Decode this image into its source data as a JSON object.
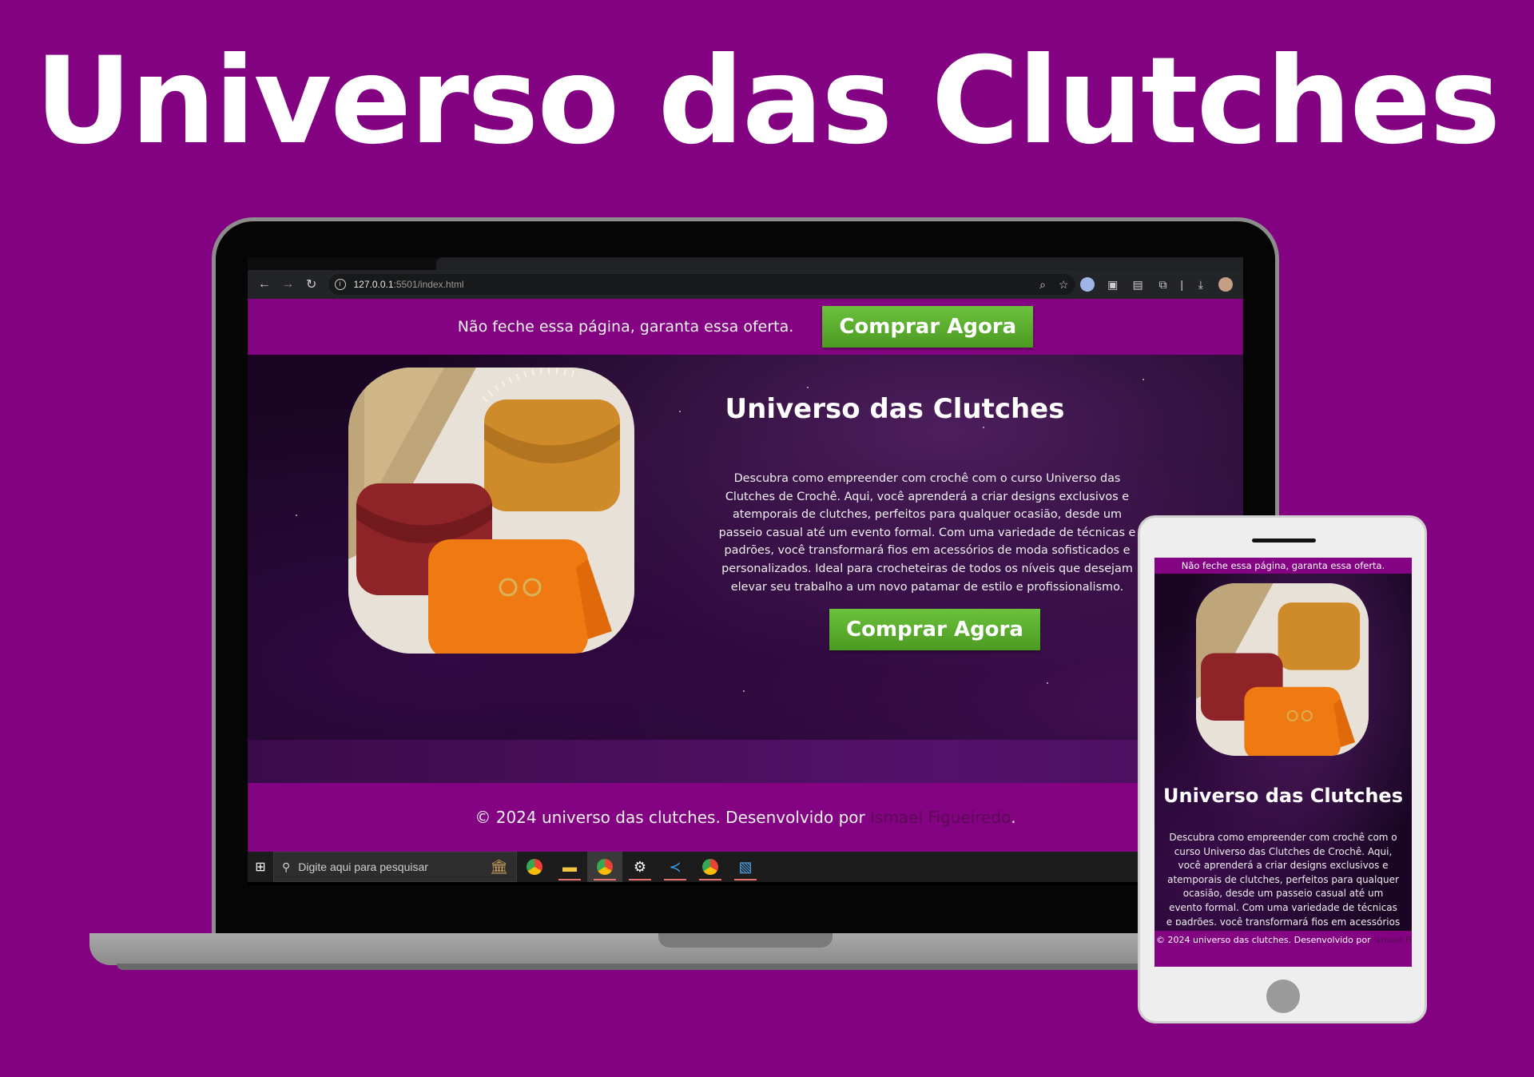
{
  "headline": "Universo das Clutches",
  "browser": {
    "url_host": "127.0.0.1",
    "url_path": ":5501/index.html"
  },
  "site": {
    "topbar_notice": "Não feche essa página, garanta essa oferta.",
    "buy_label": "Comprar Agora",
    "hero_title": "Universo das Clutches",
    "hero_description": "Descubra como empreender com crochê com o curso Universo das Clutches de Crochê. Aqui, você aprenderá a criar designs exclusivos e atemporais de clutches, perfeitos para qualquer ocasião, desde um passeio casual até um evento formal. Com uma variedade de técnicas e padrões, você transformará fios em acessórios de moda sofisticados e personalizados. Ideal para crocheteiras de todos os níveis que desejam elevar seu trabalho a um novo patamar de estilo e profissionalismo.",
    "footer_prefix": "© 2024 universo das clutches. Desenvolvido por ",
    "footer_author": "Ismael Figueiredo",
    "footer_suffix": "."
  },
  "taskbar": {
    "search_placeholder": "Digite aqui para pesquisar"
  },
  "mobile": {
    "topbar_notice": "Não feche essa página, garanta essa oferta.",
    "hero_title": "Universo das Clutches",
    "hero_description": "Descubra como empreender com crochê com o curso Universo das Clutches de Crochê. Aqui, você aprenderá a criar designs exclusivos e atemporais de clutches, perfeitos para qualquer ocasião, desde um passeio casual até um evento formal. Com uma variedade de técnicas e padrões, você transformará fios em acessórios",
    "footer_prefix": "© 2024 universo das clutches. Desenvolvido por ",
    "footer_author": "Ismael Figueiredo"
  },
  "colors": {
    "background": "#820282",
    "site_purple": "#830382",
    "button_green": "#5bad2f",
    "author_link": "#5b0a55"
  },
  "icons": [
    "back-arrow-icon",
    "forward-arrow-icon",
    "reload-icon",
    "site-info-icon",
    "zoom-icon",
    "star-icon",
    "extensions-icon",
    "download-icon",
    "profile-avatar-icon",
    "windows-start-icon",
    "search-icon",
    "chrome-icon",
    "file-explorer-icon",
    "settings-icon",
    "vscode-icon",
    "photos-icon"
  ]
}
